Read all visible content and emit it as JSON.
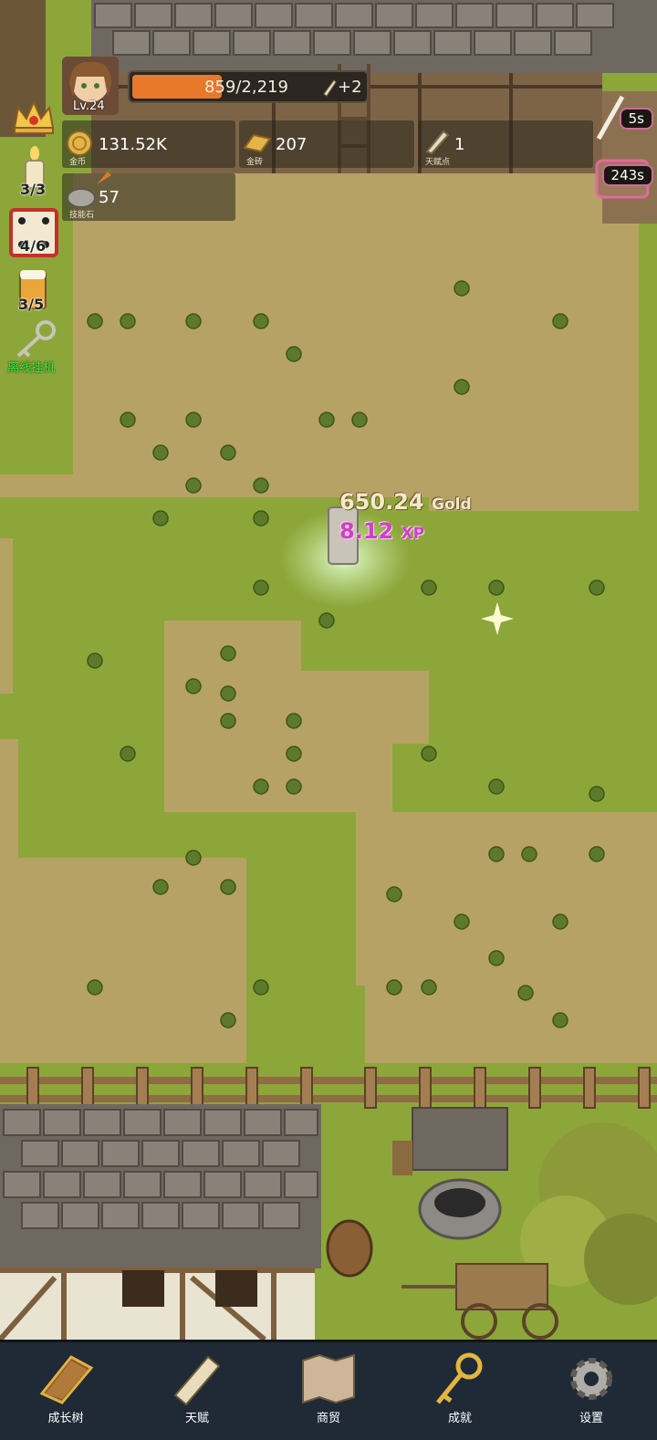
{
  "player": {
    "level": "Lv.24"
  },
  "xp": {
    "text": "859/2,219",
    "bonus": "+2",
    "progress": 0.387
  },
  "resources": {
    "gold": {
      "value": "131.52K",
      "caption": "金币"
    },
    "gold_brick": {
      "value": "207",
      "caption": "金砖"
    },
    "talent_point": {
      "value": "1",
      "caption": "天赋点"
    },
    "skill_stone": {
      "value": "57",
      "caption": "技能石"
    }
  },
  "left_menu": {
    "candle": "3/3",
    "dice": "4/6",
    "beer": "3/5",
    "idle": "离线挂机"
  },
  "timers": {
    "top": "5s",
    "chest": "243s"
  },
  "floating": {
    "gold_value": "650.24",
    "gold_unit": "Gold",
    "xp_value": "8.12",
    "xp_unit": "XP"
  },
  "nav": [
    {
      "label": "成长树",
      "icon": "book-icon"
    },
    {
      "label": "天赋",
      "icon": "scroll-icon"
    },
    {
      "label": "商贸",
      "icon": "map-icon"
    },
    {
      "label": "成就",
      "icon": "key-icon"
    },
    {
      "label": "设置",
      "icon": "gear-icon"
    }
  ],
  "colors": {
    "xp_fill": "#e8782a",
    "grass": "#8aa23a",
    "dirt": "#b19d63",
    "nav_bg": "#1f2a36"
  }
}
